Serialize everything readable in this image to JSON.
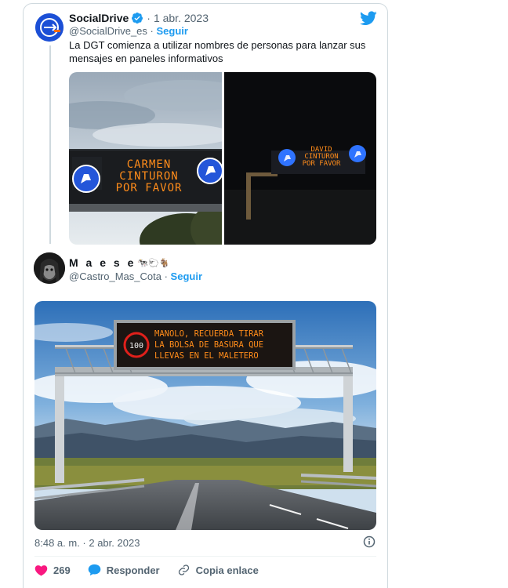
{
  "tweet_quoted": {
    "author_name": "SocialDrive",
    "date": "1 abr. 2023",
    "handle": "@SocialDrive_es",
    "follow_label": "Seguir",
    "text": "La DGT comienza a utilizar nombres de personas para lanzar sus mensajes en paneles informativos",
    "photo1_sign": [
      "CARMEN",
      "CINTURON",
      "POR FAVOR"
    ],
    "photo2_sign": [
      "DAVID",
      "CINTURON",
      "POR FAVOR"
    ]
  },
  "tweet_main": {
    "author_name": "M a e s e",
    "author_emojis": "🐄🐑🐐",
    "handle": "@Castro_Mas_Cota",
    "follow_label": "Seguir",
    "sign_speed": "100",
    "sign_lines": [
      "MANOLO, RECUERDA TIRAR",
      "LA BOLSA DE BASURA QUE",
      "LLEVAS EN EL MALETERO"
    ],
    "timestamp": "8:48 a. m. · 2 abr. 2023"
  },
  "actions": {
    "likes_count": "269",
    "reply_label": "Responder",
    "copy_label": "Copia enlace"
  },
  "colors": {
    "twitter_blue": "#1d9bf0",
    "like_red": "#f91880",
    "text_secondary": "#536471",
    "sign_orange": "#ff8c1a"
  },
  "icons": {
    "twitter": "twitter-bird-icon",
    "verified": "verified-badge-icon",
    "info": "info-icon",
    "like": "heart-icon",
    "reply": "speech-bubble-icon",
    "copy": "link-icon"
  }
}
